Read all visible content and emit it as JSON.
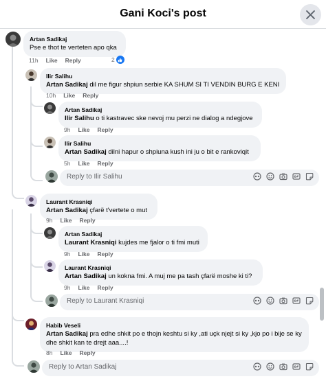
{
  "header": {
    "title": "Gani Koci's post"
  },
  "actions": {
    "like": "Like",
    "reply": "Reply"
  },
  "comments": [
    {
      "author": "Artan Sadikaj",
      "text": "Pse e thot te verteten apo qka",
      "time": "11h",
      "reactions": "2"
    },
    {
      "author": "Ilir Salihu",
      "mention": "Artan Sadikaj",
      "text": "dil me figur shpiun serbie KA SHUM SI TI VENDIN BURG E KENI",
      "time": "10h"
    },
    {
      "author": "Artan Sadikaj",
      "mention": "Ilir Salihu",
      "text": "o ti kastravec ske nevoj mu perzi ne dialog a ndegjove",
      "time": "9h"
    },
    {
      "author": "Ilir Salihu",
      "mention": "Artan Sadikaj",
      "text": "dilni hapur o shpiuna kush ini ju o bit e rankoviqit",
      "time": "5h"
    },
    {
      "author": "Laurant Krasniqi",
      "mention": "Artan Sadikaj",
      "text": "çfarë t'vertete o mut",
      "time": "9h"
    },
    {
      "author": "Artan Sadikaj",
      "mention": "Laurant Krasniqi",
      "text": "kujdes me fjalor o ti fmi muti",
      "time": "9h"
    },
    {
      "author": "Laurant Krasniqi",
      "mention": "Artan Sadikaj",
      "text": "un kokna fmi. A muj me pa tash çfarë moshe ki ti?",
      "time": "9h"
    },
    {
      "author": "Habib Veseli",
      "mention": "Artan Sadikaj",
      "text": "pra edhe shkit po e thojn keshtu si ky ,ati uçk njejt si ky ,kjo po i bije se ky dhe shkit kan te drejt aaa....!",
      "time": "8h"
    }
  ],
  "reply_boxes": [
    {
      "placeholder": "Reply to Ilir Salihu"
    },
    {
      "placeholder": "Reply to Laurant Krasniqi"
    },
    {
      "placeholder": "Reply to Artan Sadikaj"
    }
  ],
  "toolbar_icons": [
    "avatar-sticker-icon",
    "emoji-icon",
    "camera-icon",
    "gif-icon",
    "sticker-icon"
  ],
  "colors": {
    "bubble": "#f0f2f5",
    "like": "#1877f2",
    "muted": "#65676b"
  }
}
